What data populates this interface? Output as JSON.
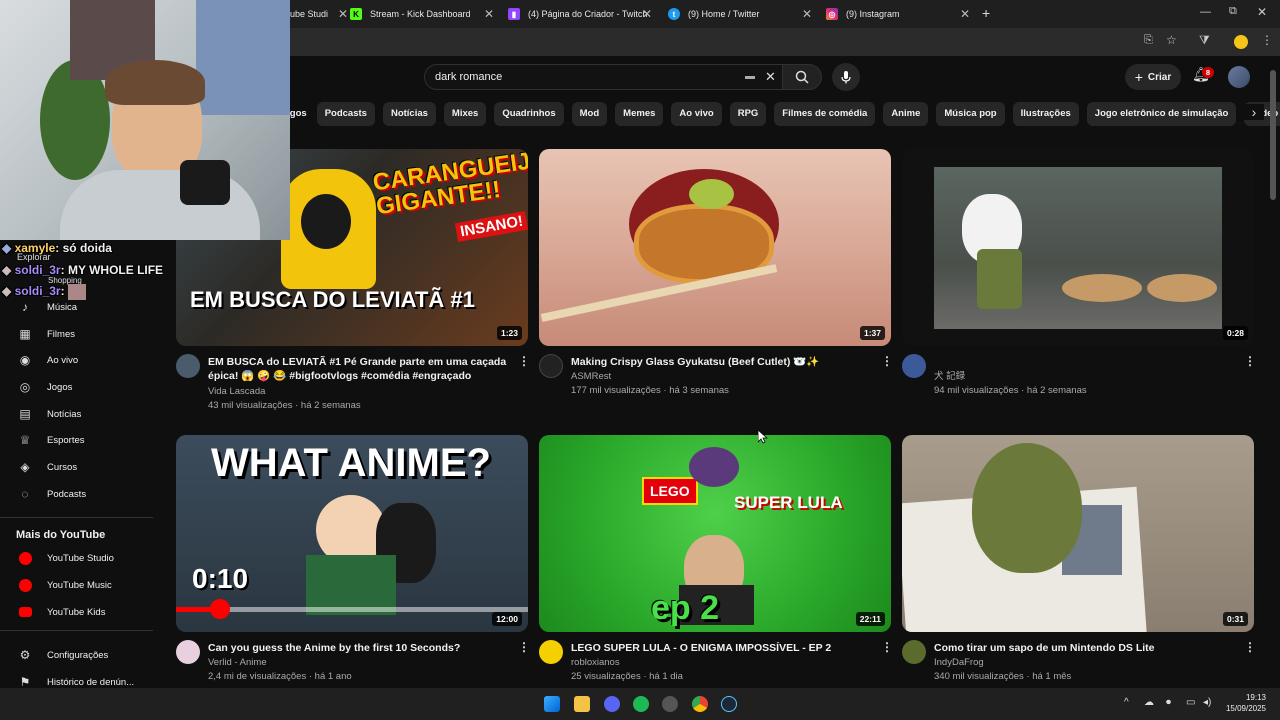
{
  "browser": {
    "tabs": [
      {
        "label": "ube Studi",
        "icon": "youtube-studio-icon"
      },
      {
        "label": "Stream - Kick Dashboard",
        "icon": "kick-icon"
      },
      {
        "label": "(4) Página do Criador - Twitch",
        "icon": "twitch-icon"
      },
      {
        "label": "(9) Home / Twitter",
        "icon": "twitter-icon"
      },
      {
        "label": "(9) Instagram",
        "icon": "instagram-icon"
      }
    ],
    "new_tab": "+"
  },
  "youtube": {
    "search": {
      "value": "dark romance"
    },
    "create_label": "Criar",
    "notification_count": "8",
    "chips": [
      "ogos",
      "Podcasts",
      "Notícias",
      "Mixes",
      "Quadrinhos",
      "Mod",
      "Memes",
      "Ao vivo",
      "RPG",
      "Filmes de comédia",
      "Anime",
      "Música pop",
      "Ilustrações",
      "Jogo eletrônico de simulação",
      "Vídeo"
    ],
    "sidebar": {
      "partial_items": [
        "Explorar",
        "Shopping"
      ],
      "items": [
        {
          "label": "Música",
          "icon": "music-icon"
        },
        {
          "label": "Filmes",
          "icon": "film-icon"
        },
        {
          "label": "Ao vivo",
          "icon": "live-icon"
        },
        {
          "label": "Jogos",
          "icon": "gamepad-icon"
        },
        {
          "label": "Notícias",
          "icon": "news-icon"
        },
        {
          "label": "Esportes",
          "icon": "trophy-icon"
        },
        {
          "label": "Cursos",
          "icon": "courses-icon"
        },
        {
          "label": "Podcasts",
          "icon": "podcast-icon"
        }
      ],
      "more_heading": "Mais do YouTube",
      "more_items": [
        {
          "label": "YouTube Studio"
        },
        {
          "label": "YouTube Music"
        },
        {
          "label": "YouTube Kids"
        }
      ],
      "bottom_items": [
        {
          "label": "Configurações",
          "icon": "gear-icon"
        },
        {
          "label": "Histórico de denún...",
          "icon": "flag-icon"
        }
      ]
    },
    "videos": [
      {
        "title": "EM BUSCA do LEVIATÃ #1 Pé Grande parte em uma caçada épica! 😱 🤪 😂 #bigfootvlogs #comédia #engraçado",
        "channel": "Vida Lascada",
        "meta": "43 mil visualizações · há 2 semanas",
        "duration": "1:23",
        "thumb_text_1": "CARANGUEIJO GIGANTE!!",
        "thumb_text_2": "INSANO!",
        "thumb_text_3": "EM BUSCA DO LEVIATÃ #1"
      },
      {
        "title": "Making Crispy Glass Gyukatsu (Beef Cutlet) 🐻‍❄️✨",
        "channel": "ASMRest",
        "meta": "177 mil visualizações · há 3 semanas",
        "duration": "1:37"
      },
      {
        "title": "",
        "channel": "犬 記録",
        "meta": "94 mil visualizações · há 2 semanas",
        "duration": "0:28"
      },
      {
        "title": "Can you guess the Anime by the first 10 Seconds?",
        "channel": "Verlid - Anime",
        "meta": "2,4 mi de visualizações · há 1 ano",
        "duration": "12:00",
        "thumb_text_1": "WHAT ANIME?",
        "thumb_text_2": "0:10"
      },
      {
        "title": "LEGO SUPER LULA - O ENIGMA IMPOSSÍVEL - EP 2",
        "channel": "robloxianos",
        "meta": "25 visualizações · há 1 dia",
        "duration": "22:11",
        "thumb_text_1": "LEGO",
        "thumb_text_2": "SUPER LULA",
        "thumb_text_3": "ep 2"
      },
      {
        "title": "Como tirar um sapo de um Nintendo DS Lite",
        "channel": "IndyDaFrog",
        "meta": "340 mil visualizações · há 1 mês",
        "duration": "0:31"
      }
    ]
  },
  "chat": [
    {
      "user": "xamyle",
      "message": "só doida",
      "color": "#ffd166"
    },
    {
      "user": "soldi_3r",
      "message": "MY WHOLE LIFE",
      "color": "#a78bfa"
    },
    {
      "user": "soldi_3r",
      "message": "",
      "color": "#a78bfa"
    }
  ],
  "taskbar": {
    "time": "19:13",
    "date": "15/09/2025"
  },
  "colors": {
    "accent": "#ff0000",
    "bg": "#0f0f0f"
  }
}
